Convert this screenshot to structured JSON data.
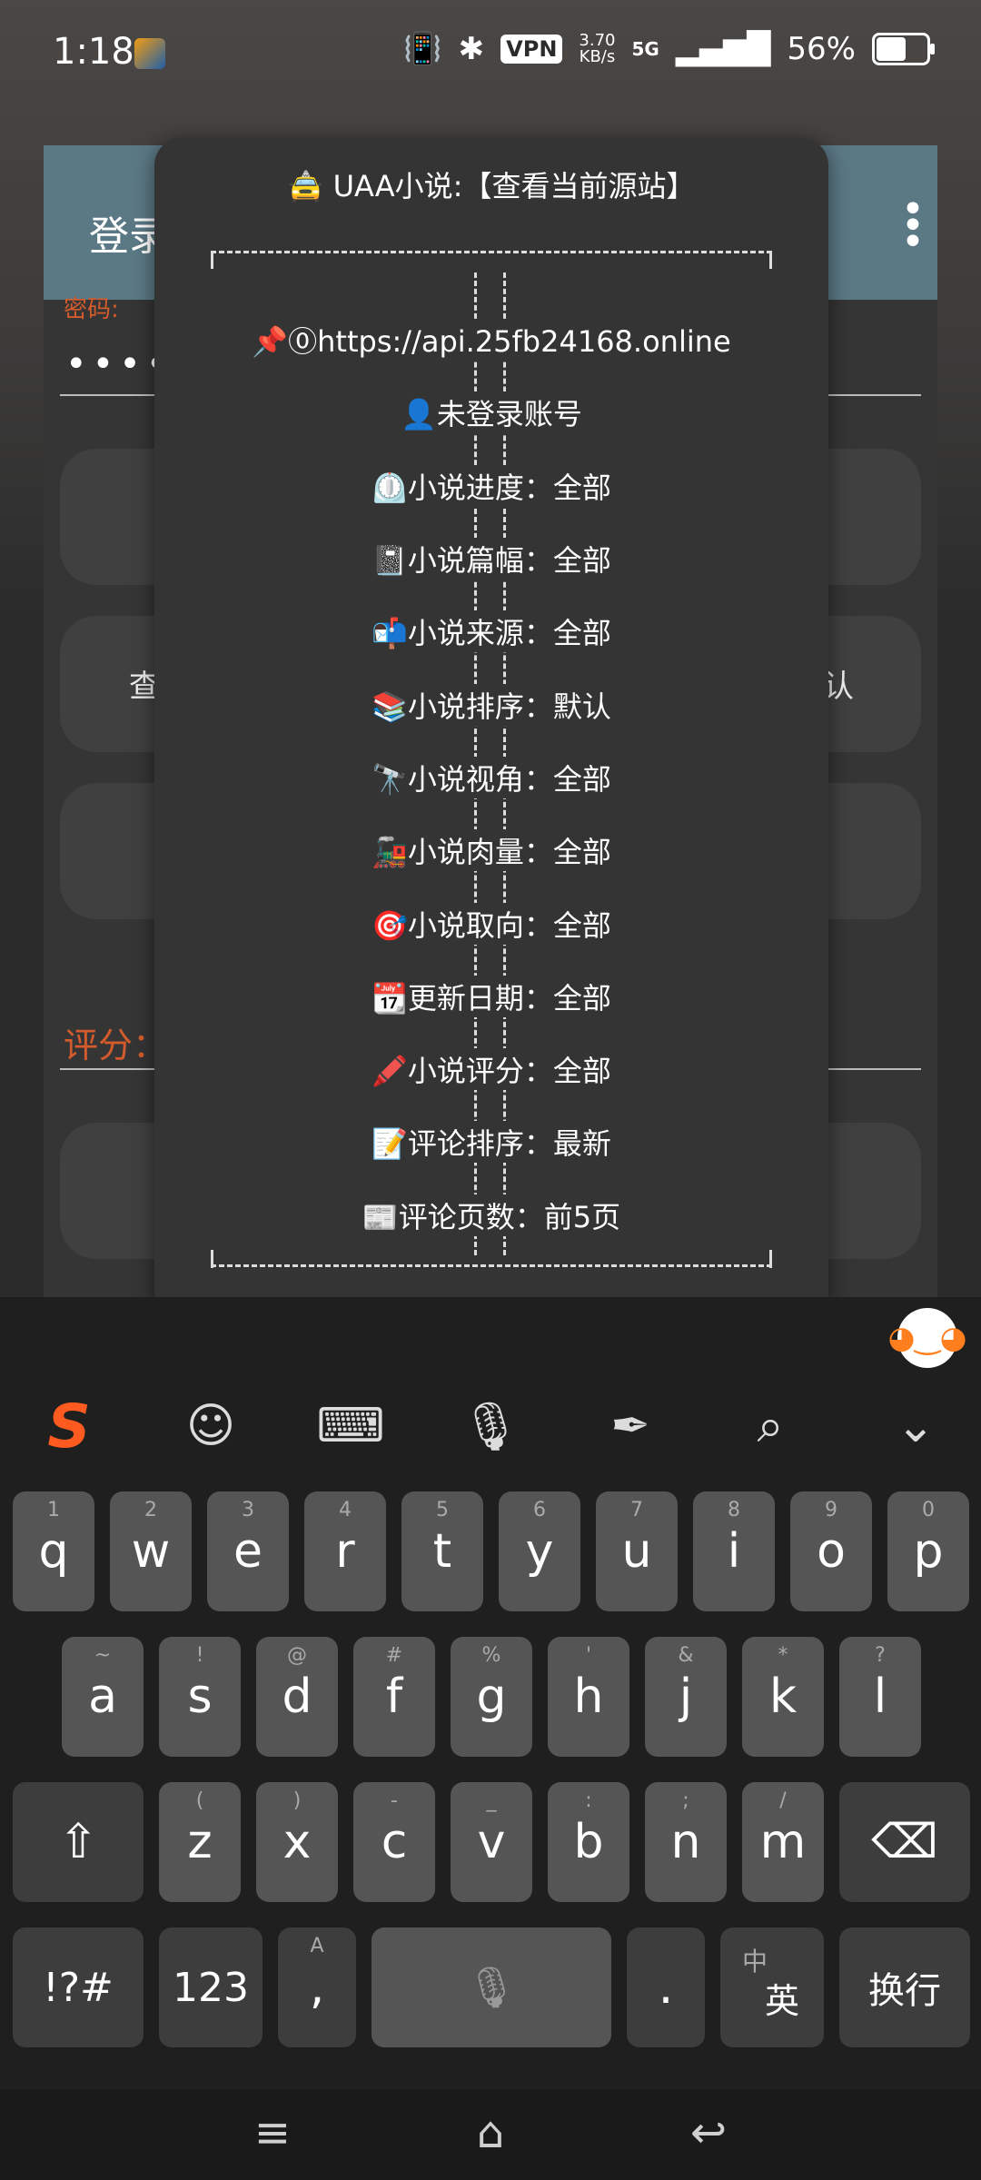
{
  "status_bar": {
    "time": "1:18",
    "vpn": "VPN",
    "speed_value": "3.70",
    "speed_unit": "KB/s",
    "network": "5G",
    "battery": "56%"
  },
  "app": {
    "title": "登录",
    "password_label": "密码:",
    "password_dots": "••••",
    "pill_left_text": "查",
    "pill_right_text": "认",
    "score_label": "评分："
  },
  "dialog": {
    "title": "🚖 UAA小说:【查看当前源站】",
    "rows": [
      "📌⓪https://api.25fb24168.online",
      "👤未登录账号",
      "⏲️小说进度：全部",
      "📓小说篇幅：全部",
      "📬小说来源：全部",
      "📚小说排序：默认",
      "🔭小说视角：全部",
      "🚂小说肉量：全部",
      "🎯小说取向：全部",
      "📆更新日期：全部",
      "🖍️小说评分：全部",
      "📝评论排序：最新",
      "📰评论页数：前5页"
    ]
  },
  "keyboard": {
    "row1": [
      [
        "q",
        "1"
      ],
      [
        "w",
        "2"
      ],
      [
        "e",
        "3"
      ],
      [
        "r",
        "4"
      ],
      [
        "t",
        "5"
      ],
      [
        "y",
        "6"
      ],
      [
        "u",
        "7"
      ],
      [
        "i",
        "8"
      ],
      [
        "o",
        "9"
      ],
      [
        "p",
        "0"
      ]
    ],
    "row2": [
      [
        "a",
        "~"
      ],
      [
        "s",
        "!"
      ],
      [
        "d",
        "@"
      ],
      [
        "f",
        "#"
      ],
      [
        "g",
        "%"
      ],
      [
        "h",
        "'"
      ],
      [
        "j",
        "&"
      ],
      [
        "k",
        "*"
      ],
      [
        "l",
        "?"
      ]
    ],
    "row3": [
      [
        "z",
        "("
      ],
      [
        "x",
        ")"
      ],
      [
        "c",
        "-"
      ],
      [
        "v",
        "_"
      ],
      [
        "b",
        ":"
      ],
      [
        "n",
        ";"
      ],
      [
        "m",
        "/"
      ]
    ],
    "symbols_key": "!?#",
    "numbers_key": "123",
    "comma_key": ",",
    "comma_hint": "A",
    "period_key": ".",
    "lang_key": "英",
    "lang_hint": "中",
    "enter_key": "换行",
    "shift_icon": "⇧",
    "backspace_icon": "⌫",
    "mic_icon": "🎙"
  },
  "toolbar": {
    "logo": "S",
    "emoji_icon": "☺",
    "keyboard_icon": "⌨",
    "voice_icon": "🎙",
    "handwrite_icon": "✒",
    "search_icon": "⌕",
    "collapse_icon": "⌄"
  },
  "navbar": {
    "menu_icon": "≡",
    "home_icon": "⌂",
    "back_icon": "↩"
  }
}
